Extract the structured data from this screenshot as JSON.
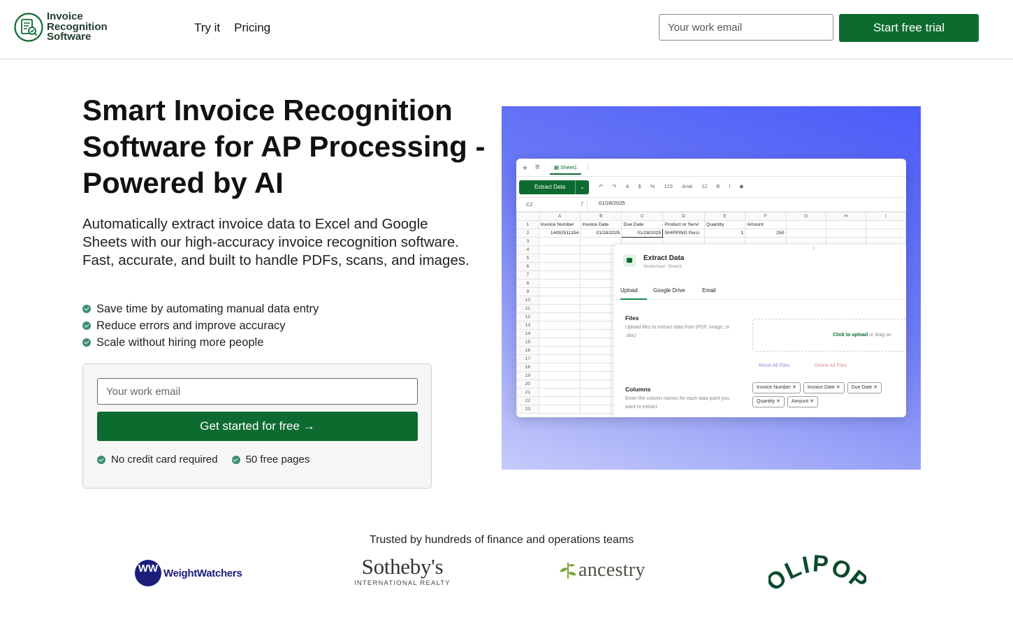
{
  "brand": {
    "name_line1": "Invoice",
    "name_line2": "Recognition",
    "name_line3": "Software",
    "color": "#0d6b30"
  },
  "nav": {
    "items": [
      "Try it",
      "Pricing"
    ]
  },
  "header": {
    "email_placeholder": "Your work email",
    "cta_label": "Start free trial"
  },
  "hero": {
    "title": "Smart Invoice Recognition Software for AP Processing - Powered by AI",
    "subtitle": "Automatically extract invoice data to Excel and Google Sheets with our high-accuracy invoice recognition software. Fast, accurate, and built to handle PDFs, scans, and images.",
    "bullets": [
      "Save time by automating manual data entry",
      "Reduce errors and improve accuracy",
      "Scale without hiring more people"
    ]
  },
  "signup": {
    "email_placeholder": "Your work email",
    "button_label": "Get started for free →",
    "notes": [
      "No credit card required",
      "50 free pages"
    ]
  },
  "sheet_preview": {
    "tab_name": "Sheet1",
    "extract_button": "Extract Data",
    "toolbar": {
      "currency": "$",
      "percent": "%",
      "number_format": "123",
      "font": "Arial",
      "font_size": "12",
      "bold": "B",
      "italic": "I"
    },
    "cell_ref": "C2",
    "formula_value": "01/28/2025",
    "columns": [
      "A",
      "B",
      "C",
      "D",
      "E",
      "F",
      "G",
      "H",
      "I"
    ],
    "header_row": [
      "Invoice Number",
      "Invoice Date",
      "Due Date",
      "Product or Servi",
      "Quantity",
      "Amount",
      "",
      "",
      ""
    ],
    "data_row": [
      "14092511154",
      "01/28/2025",
      "01/28/2025",
      "SHIPPING Perci",
      "1",
      "250",
      "",
      "",
      ""
    ],
    "row_numbers": [
      "1",
      "2",
      "3",
      "4",
      "5",
      "6",
      "7",
      "8",
      "9",
      "10",
      "11",
      "12",
      "13",
      "14",
      "15",
      "16",
      "17",
      "18",
      "19",
      "20",
      "21",
      "22",
      "23"
    ],
    "panel": {
      "title": "Extract Data",
      "subtitle": "Worksheet: Sheet1",
      "tabs": [
        "Upload",
        "Google Drive",
        "Email"
      ],
      "files_label": "Files",
      "files_desc": "Upload files to extract data from (PDF, image, or .doc)",
      "upload_link": "Click to upload",
      "upload_rest": " or drag an",
      "reset": "Reset All Files",
      "delete": "Delete All Files",
      "columns_label": "Columns",
      "columns_desc": "Enter the column names for each data point you want to extract",
      "chips": [
        "Invoice Number",
        "Invoice Date",
        "Due Date",
        "Quantity",
        "Amount"
      ]
    }
  },
  "trusted": {
    "heading": "Trusted by hundreds of finance and operations teams",
    "logos": {
      "weightwatchers": {
        "mark": "WW",
        "text": "WeightWatchers"
      },
      "sothebys": {
        "text": "Sotheby's",
        "sub": "INTERNATIONAL REALTY"
      },
      "ancestry": {
        "text": "ancestry"
      },
      "olipop": {
        "text": "OLIPOP"
      }
    }
  }
}
